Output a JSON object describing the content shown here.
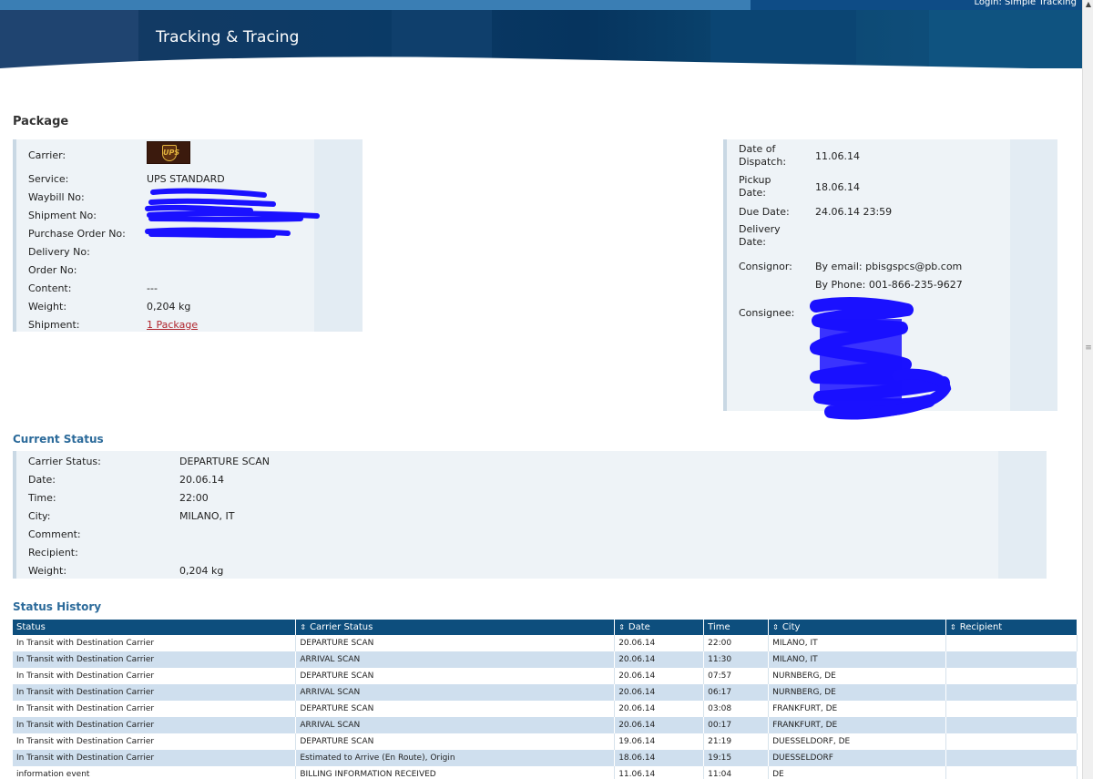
{
  "header": {
    "title": "Tracking & Tracing",
    "login_text": "Login: Simple Tracking"
  },
  "colors": {
    "header_dark": "#06345e",
    "topbar": "#3a7eb4",
    "panel_bg": "#eef3f7",
    "heading_blue": "#2b6a9a",
    "table_header": "#0d4e7d",
    "row_alt": "#cfdfee",
    "link_red": "#b0252d"
  },
  "package": {
    "heading": "Package",
    "carrier": {
      "label": "Carrier:",
      "logo": "UPS"
    },
    "service": {
      "label": "Service:",
      "value": "UPS STANDARD"
    },
    "waybill": {
      "label": "Waybill No:"
    },
    "shipment_no": {
      "label": "Shipment No:"
    },
    "purchase_order": {
      "label": "Purchase Order No:"
    },
    "delivery_no": {
      "label": "Delivery No:"
    },
    "order_no": {
      "label": "Order No:"
    },
    "content": {
      "label": "Content:",
      "value": "---"
    },
    "weight": {
      "label": "Weight:",
      "value": "0,204 kg"
    },
    "shipment": {
      "label": "Shipment:",
      "value": "1 Package"
    }
  },
  "dispatch": {
    "date_of_dispatch": {
      "label_l1": "Date of",
      "label_l2": "Dispatch:",
      "value": "11.06.14"
    },
    "pickup_date": {
      "label_l1": "Pickup",
      "label_l2": "Date:",
      "value": "18.06.14"
    },
    "due_date": {
      "label": "Due Date:",
      "value": "24.06.14 23:59"
    },
    "delivery_date": {
      "label_l1": "Delivery",
      "label_l2": "Date:"
    },
    "consignor": {
      "label": "Consignor:",
      "email": "By email: pbisgspcs@pb.com",
      "phone": "By Phone: 001-866-235-9627"
    },
    "consignee": {
      "label": "Consignee:"
    }
  },
  "current_status": {
    "heading": "Current Status",
    "carrier_status": {
      "label": "Carrier Status:",
      "value": "DEPARTURE SCAN"
    },
    "date": {
      "label": "Date:",
      "value": "20.06.14"
    },
    "time": {
      "label": "Time:",
      "value": "22:00"
    },
    "city": {
      "label": "City:",
      "value": "MILANO, IT"
    },
    "comment": {
      "label": "Comment:"
    },
    "recipient": {
      "label": "Recipient:"
    },
    "weight": {
      "label": "Weight:",
      "value": "0,204 kg"
    }
  },
  "history": {
    "heading": "Status History",
    "columns": [
      "Status",
      "Carrier Status",
      "Date",
      "Time",
      "City",
      "Recipient"
    ],
    "rows": [
      [
        "In Transit with Destination Carrier",
        "DEPARTURE SCAN",
        "20.06.14",
        "22:00",
        "MILANO, IT",
        ""
      ],
      [
        "In Transit with Destination Carrier",
        "ARRIVAL SCAN",
        "20.06.14",
        "11:30",
        "MILANO, IT",
        ""
      ],
      [
        "In Transit with Destination Carrier",
        "DEPARTURE SCAN",
        "20.06.14",
        "07:57",
        "NURNBERG, DE",
        ""
      ],
      [
        "In Transit with Destination Carrier",
        "ARRIVAL SCAN",
        "20.06.14",
        "06:17",
        "NURNBERG, DE",
        ""
      ],
      [
        "In Transit with Destination Carrier",
        "DEPARTURE SCAN",
        "20.06.14",
        "03:08",
        "FRANKFURT, DE",
        ""
      ],
      [
        "In Transit with Destination Carrier",
        "ARRIVAL SCAN",
        "20.06.14",
        "00:17",
        "FRANKFURT, DE",
        ""
      ],
      [
        "In Transit with Destination Carrier",
        "DEPARTURE SCAN",
        "19.06.14",
        "21:19",
        "DUESSELDORF, DE",
        ""
      ],
      [
        "In Transit with Destination Carrier",
        "Estimated to Arrive (En Route), Origin",
        "18.06.14",
        "19:15",
        "DUESSELDORF",
        ""
      ],
      [
        "information event",
        "BILLING INFORMATION RECEIVED",
        "11.06.14",
        "11:04",
        "DE",
        ""
      ]
    ]
  }
}
